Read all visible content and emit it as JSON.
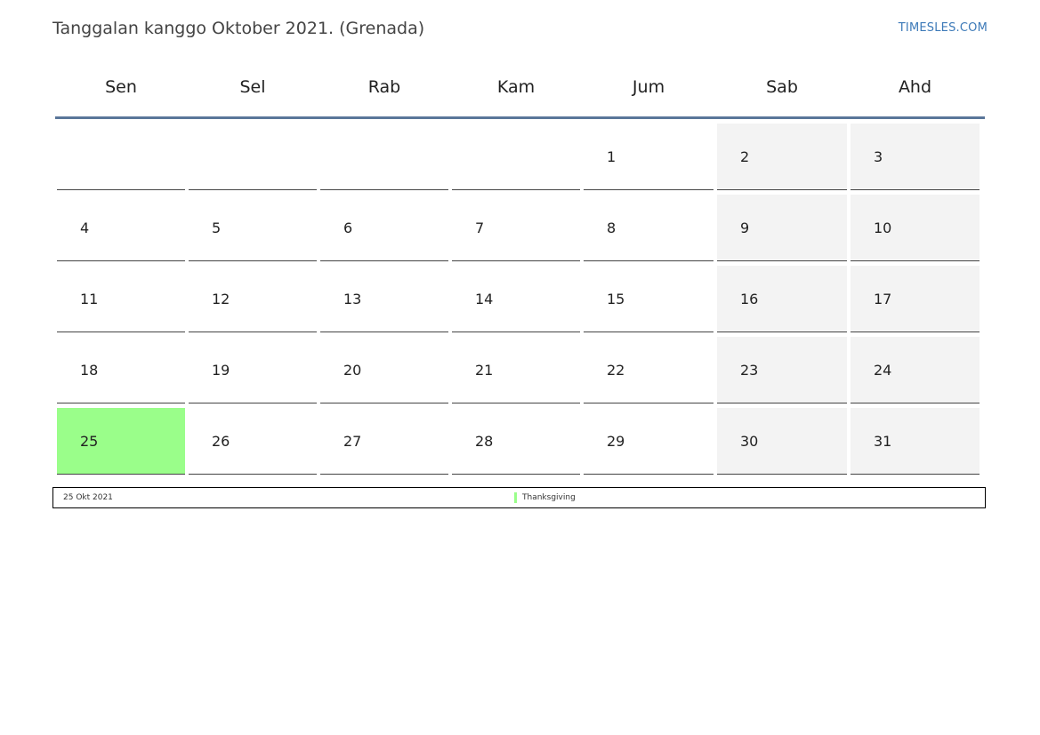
{
  "header": {
    "title": "Tanggalan kanggo Oktober 2021. (Grenada)",
    "brand": "TIMESLES.COM"
  },
  "calendar": {
    "weekdays": [
      "Sen",
      "Sel",
      "Rab",
      "Kam",
      "Jum",
      "Sab",
      "Ahd"
    ],
    "weeks": [
      [
        "",
        "",
        "",
        "",
        "1",
        "2",
        "3"
      ],
      [
        "4",
        "5",
        "6",
        "7",
        "8",
        "9",
        "10"
      ],
      [
        "11",
        "12",
        "13",
        "14",
        "15",
        "16",
        "17"
      ],
      [
        "18",
        "19",
        "20",
        "21",
        "22",
        "23",
        "24"
      ],
      [
        "25",
        "26",
        "27",
        "28",
        "29",
        "30",
        "31"
      ]
    ],
    "highlighted_day": "25",
    "colors": {
      "holiday": "#9afe8a",
      "weekend": "#f3f3f3",
      "header_rule": "#5a7699",
      "brand": "#3d7ab8"
    }
  },
  "legend": {
    "date": "25 Okt 2021",
    "holiday_name": "Thanksgiving"
  }
}
